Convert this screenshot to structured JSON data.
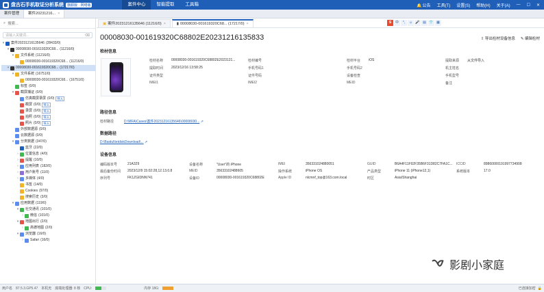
{
  "titlebar": {
    "app_title": "盘古石手机取证分析系统",
    "version_badge": "旗舰版 · 网络版",
    "menu": [
      "案件中心",
      "智能提取",
      "工具箱"
    ],
    "right": [
      "公告",
      "工具(T)",
      "设置(S)",
      "帮助(H)",
      "关于(A)"
    ]
  },
  "tabs": [
    "案件管理",
    "案件20231216..."
  ],
  "sidebar": {
    "search_label": "搜索...",
    "filter_placeholder": "请输入关键词...",
    "tree": [
      {
        "indent": 0,
        "tog": "▾",
        "color": "#1f5fb8",
        "label": "案件20231216135646",
        "count": "(28433/0)"
      },
      {
        "indent": 1,
        "tog": "▾",
        "color": "#333333",
        "label": "00008030-001619320C68...",
        "count": "(11216/0)"
      },
      {
        "indent": 2,
        "tog": "▾",
        "color": "#f0b429",
        "label": "文件系统",
        "count": "(11216/0)"
      },
      {
        "indent": 3,
        "tog": "",
        "color": "#f0b429",
        "label": "00008030-001619320C68...",
        "count": "(11216/0)"
      },
      {
        "indent": 1,
        "tog": "▾",
        "color": "#333333",
        "label": "00008030-001619320C68...",
        "count": "(17217/0)",
        "sel": true
      },
      {
        "indent": 2,
        "tog": "▾",
        "color": "#f0b429",
        "label": "文件系统",
        "count": "(16751/0)"
      },
      {
        "indent": 3,
        "tog": "",
        "color": "#f0b429",
        "label": "00008030-001619320C68...",
        "count": "(16751/0)"
      },
      {
        "indent": 2,
        "tog": "",
        "color": "#3fb950",
        "label": "标签",
        "count": "(0/0)"
      },
      {
        "indent": 2,
        "tog": "▾",
        "color": "#e5534b",
        "label": "截屏捕证",
        "count": "(0/0)"
      },
      {
        "indent": 3,
        "tog": "",
        "color": "#5b8def",
        "label": "仿真截屏录屏",
        "count": "(0/0)",
        "imp": "导入"
      },
      {
        "indent": 3,
        "tog": "",
        "color": "#e5534b",
        "label": "截屏",
        "count": "(0/0)",
        "imp": "导入"
      },
      {
        "indent": 3,
        "tog": "",
        "color": "#e5534b",
        "label": "录屏",
        "count": "(0/0)",
        "imp": "导入"
      },
      {
        "indent": 3,
        "tog": "",
        "color": "#e5534b",
        "label": "拍照",
        "count": "(0/0)",
        "imp": "导入"
      },
      {
        "indent": 3,
        "tog": "",
        "color": "#e5534b",
        "label": "照片",
        "count": "(0/0)",
        "imp": "导入"
      },
      {
        "indent": 2,
        "tog": "",
        "color": "#5b8def",
        "label": "外部数据源",
        "count": "(0/0)"
      },
      {
        "indent": 2,
        "tog": "",
        "color": "#5b8def",
        "label": "云数据源",
        "count": "(0/0)"
      },
      {
        "indent": 2,
        "tog": "▾",
        "color": "#5b8def",
        "label": "分类数据",
        "count": "(347/0)"
      },
      {
        "indent": 3,
        "tog": "",
        "color": "#1f5fb8",
        "label": "蓝牙",
        "count": "(22/0)"
      },
      {
        "indent": 3,
        "tog": "›",
        "color": "#3fb950",
        "label": "位置信息",
        "count": "(4/0)"
      },
      {
        "indent": 3,
        "tog": "›",
        "color": "#e5534b",
        "label": "提醒",
        "count": "(10/0)"
      },
      {
        "indent": 3,
        "tog": "›",
        "color": "#5b8def",
        "label": "应用列表",
        "count": "(182/0)"
      },
      {
        "indent": 3,
        "tog": "›",
        "color": "#8e6fd8",
        "label": "用户账号",
        "count": "(11/0)"
      },
      {
        "indent": 3,
        "tog": "›",
        "color": "#5b8def",
        "label": "多媒体",
        "count": "(4/0)"
      },
      {
        "indent": 3,
        "tog": "",
        "color": "#f0b429",
        "label": "书签",
        "count": "(14/0)"
      },
      {
        "indent": 3,
        "tog": "",
        "color": "#f0b429",
        "label": "Cookies",
        "count": "(97/0)"
      },
      {
        "indent": 3,
        "tog": "",
        "color": "#f0b429",
        "label": "搜索历史",
        "count": "(3/0)"
      },
      {
        "indent": 2,
        "tog": "▾",
        "color": "#5b8def",
        "label": "应用数据",
        "count": "(119/0)"
      },
      {
        "indent": 3,
        "tog": "▾",
        "color": "#3fb950",
        "label": "社交通讯",
        "count": "(101/0)"
      },
      {
        "indent": 4,
        "tog": "›",
        "color": "#3fb950",
        "label": "微信",
        "count": "(101/0)"
      },
      {
        "indent": 3,
        "tog": "▾",
        "color": "#e5534b",
        "label": "地图出行",
        "count": "(2/0)"
      },
      {
        "indent": 4,
        "tog": "›",
        "color": "#3fb950",
        "label": "高德地图",
        "count": "(2/0)"
      },
      {
        "indent": 3,
        "tog": "▾",
        "color": "#5b8def",
        "label": "浏览器",
        "count": "(16/0)"
      },
      {
        "indent": 4,
        "tog": "›",
        "color": "#5b8def",
        "label": "Safari",
        "count": "(16/0)"
      }
    ]
  },
  "main": {
    "subtabs": [
      "案件20231216135646 (11216/0)",
      "00008030-001619320C68... (17217/0)"
    ],
    "ime": [
      "S",
      "中",
      "°,",
      "☺",
      "🎤",
      "▤",
      "👕",
      "▦"
    ],
    "title": "00008030-001619320C68802E20231216135833",
    "actions": [
      "导出检材设备信息",
      "编辑检材"
    ],
    "sections": {
      "basic": "检材信息",
      "path": "路径信息",
      "dataset": "数据路径",
      "device": "设备信息"
    },
    "basic": {
      "rows": [
        [
          [
            "检材名称",
            "00008030-001619320C68802E2023121..."
          ],
          [
            "检材编号",
            ""
          ],
          [
            "检材平台",
            "iOS"
          ],
          [
            "提取来源",
            "从文件导入"
          ]
        ],
        [
          [
            "提取时间",
            "2023/12/16 13:58:25"
          ],
          [
            "手机号码1",
            ""
          ],
          [
            "手机号码2",
            ""
          ],
          [
            "机主姓名",
            ""
          ]
        ],
        [
          [
            "证件类型",
            ""
          ],
          [
            "证件号码",
            ""
          ],
          [
            "设备检查",
            ""
          ],
          [
            "手机型号",
            ""
          ]
        ],
        [
          [
            "IMEI1",
            ""
          ],
          [
            "IMEI2",
            ""
          ],
          [
            "MEID",
            ""
          ],
          [
            "备注",
            ""
          ]
        ]
      ]
    },
    "path": {
      "label": "检材路径",
      "value": "D:\\MFA\\Cases\\案件20231216135646\\00008030..."
    },
    "dataset_path": "D:\\BaiduNetdiskDownload\\...",
    "device": {
      "rows": [
        [
          [
            "编码版本号",
            "21A329"
          ],
          [
            "设备名称",
            "\"User\"的 iPhone"
          ],
          [
            "IMEI",
            "356331024880051"
          ],
          [
            "GUID",
            "B6A4F11F92F35B6F31D82C7FA1C..."
          ],
          [
            "ICCID",
            "89860000191997734908"
          ]
        ],
        [
          [
            "最后备份时间",
            "2023/12/9 15:02:28,12.13.0.8"
          ],
          [
            "MEID",
            "35633102488605"
          ],
          [
            "操作系统",
            "iPhone OS"
          ],
          [
            "产品类型",
            "iPhone 11 (iPhone12,1)"
          ],
          [
            "系统版本",
            "17.0"
          ]
        ],
        [
          [
            "序列号",
            "FK1ZGIDNN741"
          ],
          [
            "设备ID",
            "00008030-001619320C68802E"
          ],
          [
            "Apple ID",
            "nlcmnf_top@163.com.local"
          ],
          [
            "时区",
            "Asia/Shanghai"
          ],
          [
            "",
            ""
          ]
        ]
      ]
    }
  },
  "statusbar": {
    "items": [
      "用户名",
      "87.5.3.GP5.47",
      "本机无",
      "底端处理器: 8 核",
      "CPU:",
      "内存 18G:"
    ],
    "cpu_fill": 0.55,
    "mem_fill": 0.95,
    "right": "已连接加密",
    "colors": {
      "cpu": "#3fb950",
      "mem": "#f0a030"
    }
  },
  "watermark": {
    "text": "影剧小家庭"
  }
}
